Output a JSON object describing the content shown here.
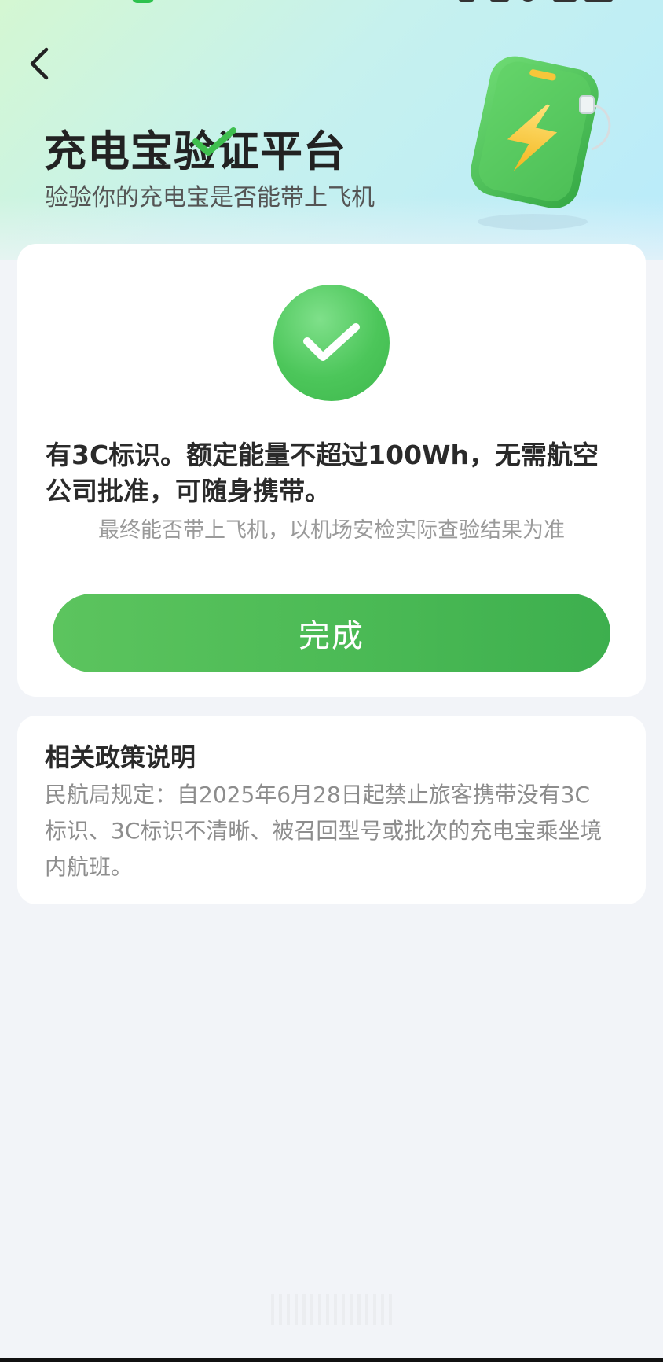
{
  "header": {
    "back_icon": "chevron-left-icon",
    "title": "充电宝验证平台",
    "subtitle": "验验你的充电宝是否能带上飞机",
    "illustration": "powerbank-icon"
  },
  "result": {
    "status_icon": "check-circle-icon",
    "message": "有3C标识。额定能量不超过100Wh，无需航空公司批准，可随身携带。",
    "note": "最终能否带上飞机，以机场安检实际查验结果为准",
    "done_label": "完成"
  },
  "policy": {
    "title": "相关政策说明",
    "body": "民航局规定：自2025年6月28日起禁止旅客携带没有3C标识、3C标识不清晰、被召回型号或批次的充电宝乘坐境内航班。"
  },
  "colors": {
    "accent": "#4bba55",
    "hero_start": "#d4f7d2",
    "hero_end": "#b9ebfb",
    "background": "#f2f4f8"
  }
}
